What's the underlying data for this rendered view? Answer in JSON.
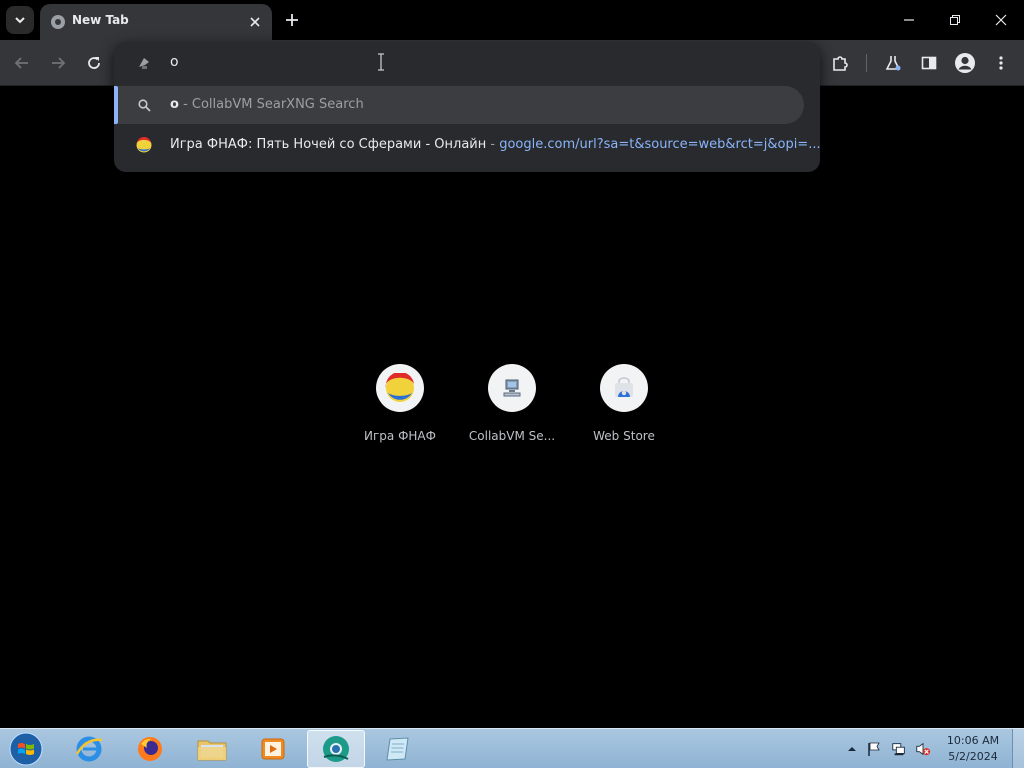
{
  "tab": {
    "title": "New Tab"
  },
  "omnibox": {
    "input_value": "o",
    "suggestions": [
      {
        "query": "o",
        "separator": " - ",
        "description": "CollabVM SearXNG Search"
      },
      {
        "title": "Игра ФНАФ: Пять Ночей со Сферами - Онлайн",
        "separator": " - ",
        "url": "google.com/url?sa=t&source=web&rct=j&opi=..."
      }
    ]
  },
  "shortcuts": [
    {
      "label": "Игра ФНАФ"
    },
    {
      "label": "CollabVM Se..."
    },
    {
      "label": "Web Store"
    }
  ],
  "taskbar": {
    "clock": {
      "time": "10:06 AM",
      "date": "5/2/2024"
    },
    "apps": [
      "internet-explorer",
      "firefox",
      "file-explorer",
      "media-player",
      "chromium",
      "notepad"
    ]
  },
  "colors": {
    "accent": "#8ab4f8",
    "tab_bg": "#35363a",
    "dropdown_bg": "#282a2e"
  }
}
